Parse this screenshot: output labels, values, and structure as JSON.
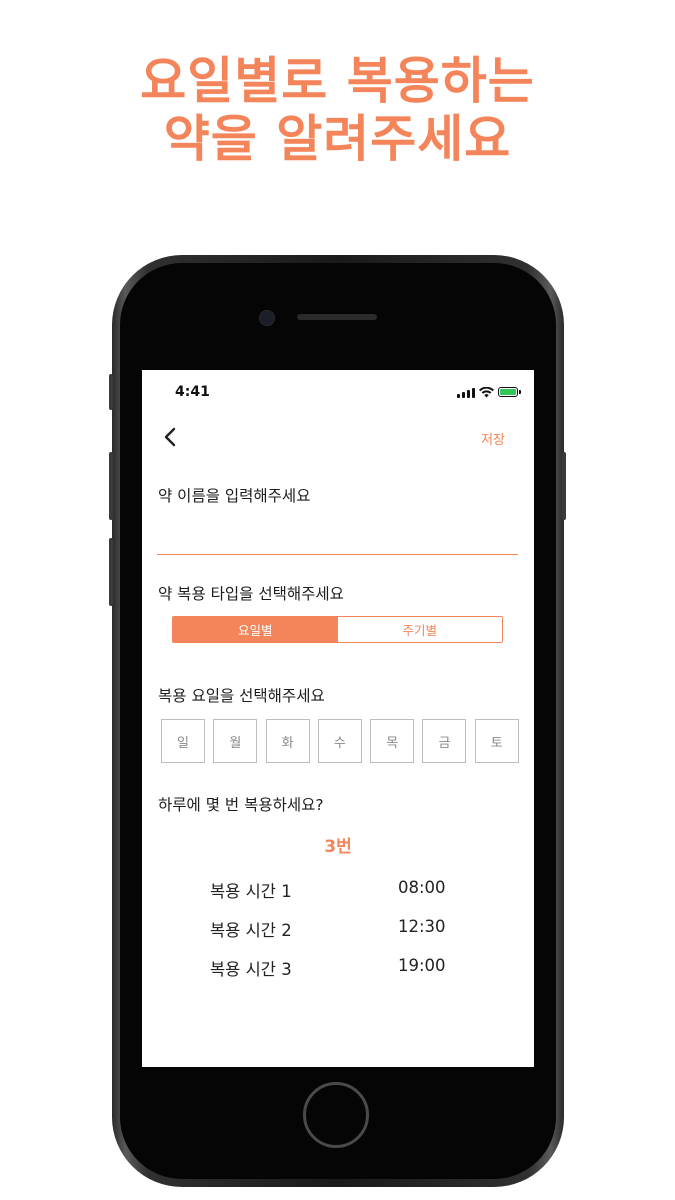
{
  "headline": {
    "line1": "요일별로 복용하는",
    "line2": "약을 알려주세요"
  },
  "status_bar": {
    "time": "4:41"
  },
  "nav": {
    "save_label": "저장"
  },
  "form": {
    "name_label": "약 이름을 입력해주세요",
    "name_value": "",
    "type_label": "약 복용 타입을 선택해주세요",
    "type_options": [
      "요일별",
      "주기별"
    ],
    "type_selected": "요일별",
    "days_label": "복용 요일을 선택해주세요",
    "days": [
      "일",
      "월",
      "화",
      "수",
      "목",
      "금",
      "토"
    ],
    "frequency_label": "하루에 몇 번 복용하세요?",
    "frequency_value": "3번",
    "times": [
      {
        "label": "복용 시간 1",
        "value": "08:00"
      },
      {
        "label": "복용 시간 2",
        "value": "12:30"
      },
      {
        "label": "복용 시간 3",
        "value": "19:00"
      }
    ]
  },
  "colors": {
    "accent": "#f4845a",
    "battery": "#33c759"
  }
}
